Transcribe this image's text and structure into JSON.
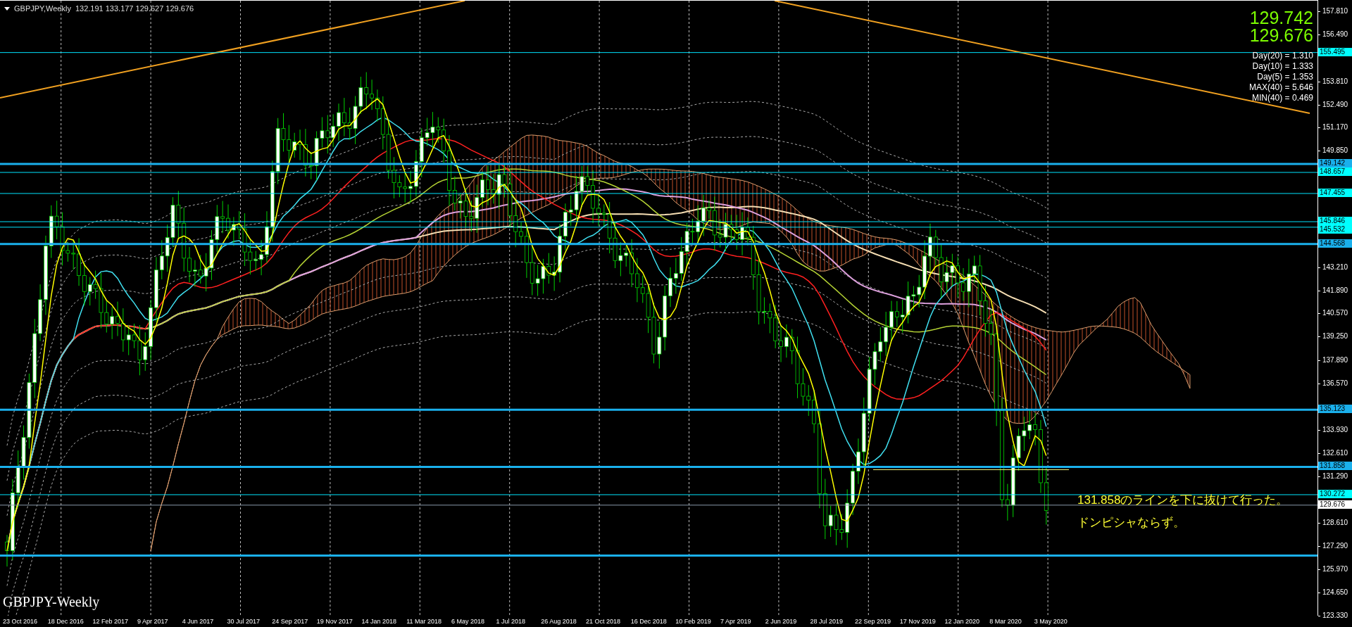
{
  "header": {
    "symbol": "GBPJPY,Weekly",
    "ohlc": "132.191 133.177 129.627 129.676"
  },
  "quotes": [
    "129.742",
    "129.676"
  ],
  "stats": [
    "Day(20) = 1.310",
    "Day(10) = 1.333",
    "Day(5) = 1.353",
    "MAX(40) = 5.646",
    "MIN(40) = 0.469"
  ],
  "price_lines": [
    {
      "label": "155.495",
      "kind": "thin"
    },
    {
      "label": "149.142",
      "kind": "thick"
    },
    {
      "label": "148.657",
      "kind": "thin"
    },
    {
      "label": "147.455",
      "kind": "thin"
    },
    {
      "label": "145.846",
      "kind": "thin"
    },
    {
      "label": "145.532",
      "kind": "thin"
    },
    {
      "label": "144.568",
      "kind": "thick"
    },
    {
      "label": "135.123",
      "kind": "thick"
    },
    {
      "label": "131.858",
      "kind": "thick"
    },
    {
      "label": "130.272",
      "kind": "thin"
    },
    {
      "label": "129.676",
      "kind": "bid"
    }
  ],
  "price_axis": [
    "157.810",
    "156.490",
    "153.810",
    "152.490",
    "151.170",
    "149.850",
    "143.210",
    "141.890",
    "140.570",
    "139.250",
    "137.890",
    "136.570",
    "133.930",
    "132.610",
    "131.290",
    "128.610",
    "127.290",
    "125.970",
    "124.650",
    "123.330"
  ],
  "time_axis": [
    "23 Oct 2016",
    "18 Dec 2016",
    "12 Feb 2017",
    "9 Apr 2017",
    "4 Jun 2017",
    "30 Jul 2017",
    "24 Sep 2017",
    "19 Nov 2017",
    "14 Jan 2018",
    "11 Mar 2018",
    "6 May 2018",
    "1 Jul 2018",
    "26 Aug 2018",
    "21 Oct 2018",
    "16 Dec 2018",
    "10 Feb 2019",
    "7 Apr 2019",
    "2 Jun 2019",
    "28 Jul 2019",
    "22 Sep 2019",
    "17 Nov 2019",
    "12 Jan 2020",
    "8 Mar 2020",
    "3 May 2020"
  ],
  "annotations": [
    "131.858のラインを下に抜けて行った。",
    "ドンピシャならず。"
  ],
  "chart_label": "GBPJPY-Weekly"
}
